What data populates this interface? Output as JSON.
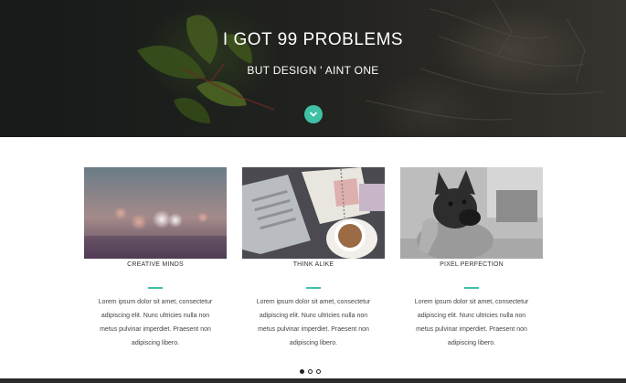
{
  "hero": {
    "title": "I GOT 99 PROBLEMS",
    "subtitle": "BUT DESIGN ' AINT ONE",
    "scroll_icon": "chevron-down-icon",
    "accent_color": "#3fc1a5"
  },
  "features": [
    {
      "title": "CREATIVE MINDS",
      "lines": [
        "Lorem ipsum dolor sit amet, consectetur",
        "adipiscing elit. Nunc ultricies nulla non",
        "metus pulvinar imperdiet. Praesent non",
        "adipiscing libero."
      ]
    },
    {
      "title": "THINK ALIKE",
      "lines": [
        "Lorem ipsum dolor sit amet, consectetur",
        "adipiscing elit. Nunc ultricies nulla non",
        "metus pulvinar imperdiet. Praesent non",
        "adipiscing libero."
      ]
    },
    {
      "title": "PIXEL PERFECTION",
      "lines": [
        "Lorem ipsum dolor sit amet, consectetur",
        "adipiscing elit. Nunc ultricies nulla non",
        "metus pulvinar imperdiet. Praesent non",
        "adipiscing libero."
      ]
    }
  ],
  "pager": {
    "count": 3,
    "active_index": 0
  }
}
